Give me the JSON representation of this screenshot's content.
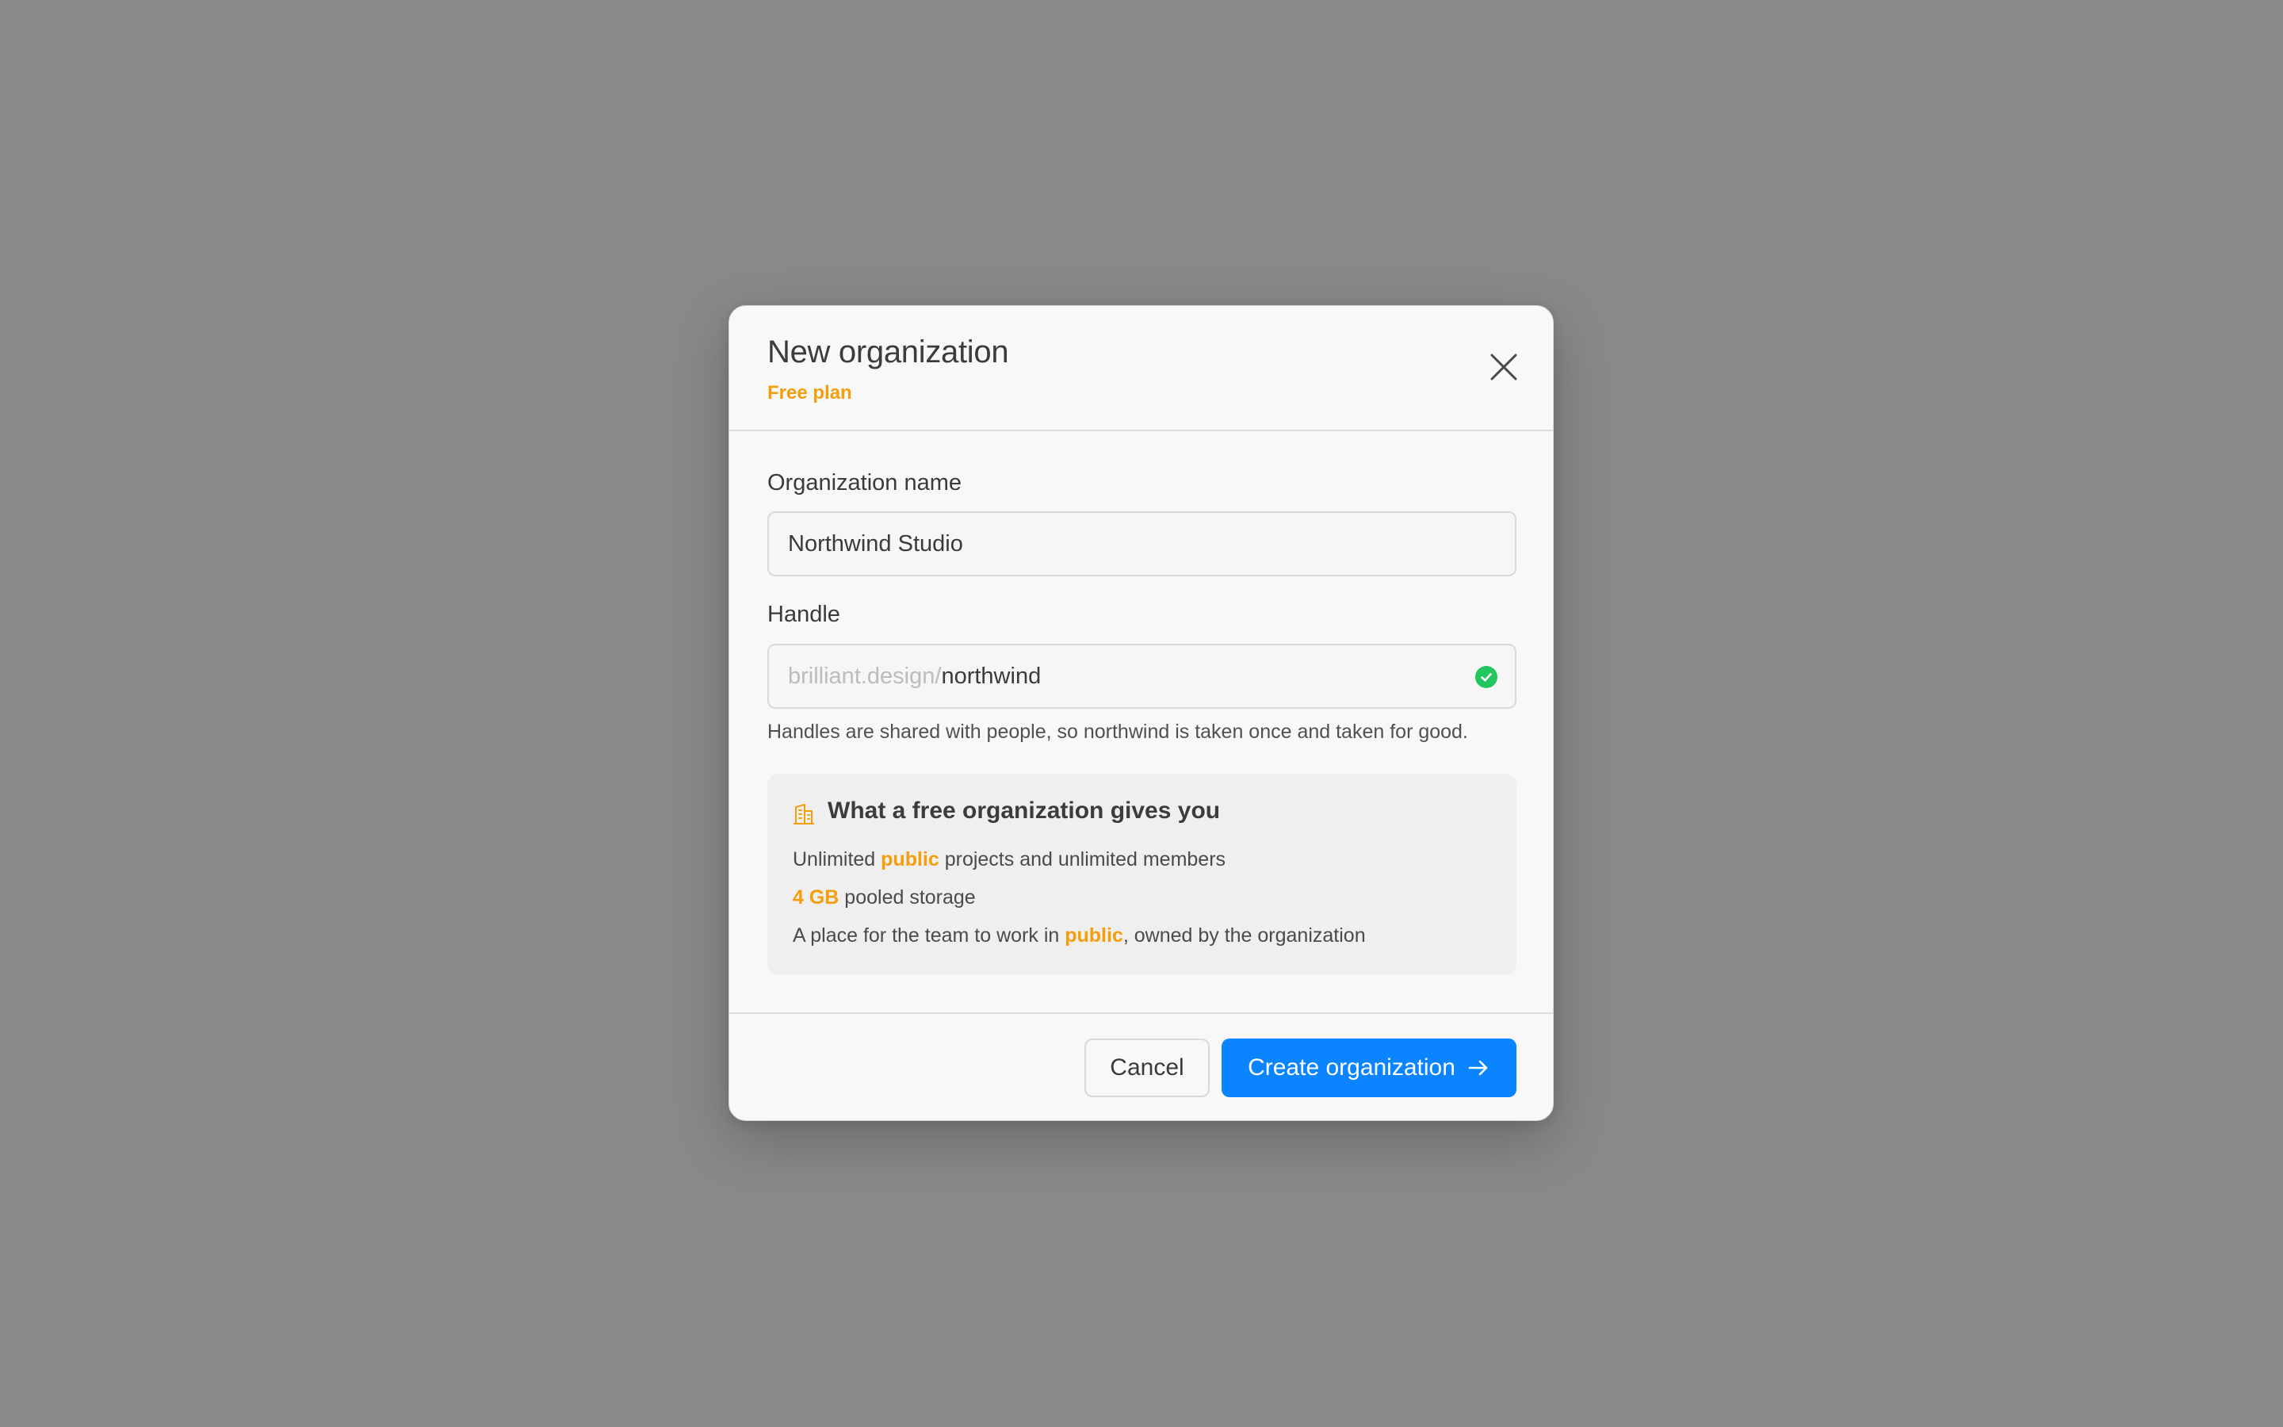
{
  "modal": {
    "title": "New organization",
    "subtitle": "Free plan",
    "close_icon": "close-icon"
  },
  "form": {
    "org_name": {
      "label": "Organization name",
      "value": "Northwind Studio"
    },
    "handle": {
      "label": "Handle",
      "prefix": "brilliant.design/",
      "value": "northwind",
      "status_icon": "check-circle-icon",
      "hint": "Handles are shared with people, so northwind is taken once and taken for good."
    }
  },
  "info": {
    "icon": "building-icon",
    "title": "What a free organization gives you",
    "lines": [
      {
        "pre": "Unlimited ",
        "highlight": "public",
        "post": " projects and unlimited members"
      },
      {
        "pre": "",
        "highlight": "4 GB",
        "post": " pooled storage"
      },
      {
        "pre": "A place for the team to work in ",
        "highlight": "public",
        "post": ", owned by the organization"
      }
    ]
  },
  "footer": {
    "cancel_label": "Cancel",
    "create_label": "Create organization",
    "create_icon": "arrow-right-icon"
  },
  "colors": {
    "accent": "#f59e0b",
    "primary": "#0a84ff",
    "success": "#22c55e",
    "backdrop": "#898989"
  }
}
